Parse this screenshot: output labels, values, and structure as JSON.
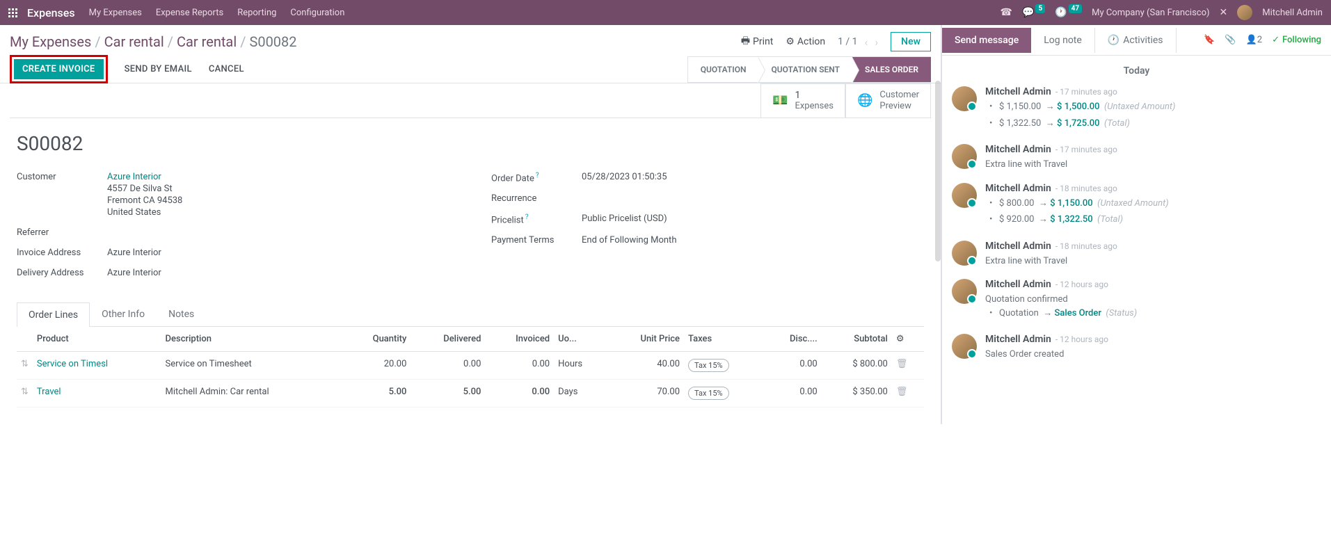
{
  "topnav": {
    "brand": "Expenses",
    "links": [
      "My Expenses",
      "Expense Reports",
      "Reporting",
      "Configuration"
    ],
    "msg_badge": "5",
    "clock_badge": "47",
    "company": "My Company (San Francisco)",
    "user": "Mitchell Admin"
  },
  "breadcrumb": {
    "parts": [
      "My Expenses",
      "Car rental",
      "Car rental"
    ],
    "current": "S00082"
  },
  "toolbar": {
    "print": "Print",
    "action": "Action",
    "pager": "1 / 1",
    "new": "New"
  },
  "actions": {
    "create_invoice": "CREATE INVOICE",
    "send_by_email": "SEND BY EMAIL",
    "cancel": "CANCEL"
  },
  "status_pills": [
    "QUOTATION",
    "QUOTATION SENT",
    "SALES ORDER"
  ],
  "widgets": {
    "expenses_count": "1",
    "expenses_label": "Expenses",
    "customer_preview_l1": "Customer",
    "customer_preview_l2": "Preview"
  },
  "record": {
    "title": "S00082",
    "labels": {
      "customer": "Customer",
      "referrer": "Referrer",
      "invoice_address": "Invoice Address",
      "delivery_address": "Delivery Address",
      "order_date": "Order Date",
      "recurrence": "Recurrence",
      "pricelist": "Pricelist",
      "payment_terms": "Payment Terms"
    },
    "customer_name": "Azure Interior",
    "customer_addr1": "4557 De Silva St",
    "customer_addr2": "Fremont CA 94538",
    "customer_addr3": "United States",
    "invoice_address": "Azure Interior",
    "delivery_address": "Azure Interior",
    "order_date": "05/28/2023 01:50:35",
    "pricelist": "Public Pricelist (USD)",
    "payment_terms": "End of Following Month"
  },
  "tabs": [
    "Order Lines",
    "Other Info",
    "Notes"
  ],
  "table": {
    "headers": {
      "product": "Product",
      "description": "Description",
      "quantity": "Quantity",
      "delivered": "Delivered",
      "invoiced": "Invoiced",
      "uom": "Uo...",
      "unit_price": "Unit Price",
      "taxes": "Taxes",
      "disc": "Disc....",
      "subtotal": "Subtotal"
    },
    "rows": [
      {
        "product": "Service on Timesl",
        "description": "Service on Timesheet",
        "quantity": "20.00",
        "delivered": "0.00",
        "invoiced": "0.00",
        "uom": "Hours",
        "unit_price": "40.00",
        "taxes": "Tax 15%",
        "disc": "0.00",
        "subtotal": "$ 800.00",
        "teal": false
      },
      {
        "product": "Travel",
        "description": "Mitchell Admin: Car rental",
        "quantity": "5.00",
        "delivered": "5.00",
        "invoiced": "0.00",
        "uom": "Days",
        "unit_price": "70.00",
        "taxes": "Tax 15%",
        "disc": "0.00",
        "subtotal": "$ 350.00",
        "teal": true
      }
    ]
  },
  "chatter": {
    "send_message": "Send message",
    "log_note": "Log note",
    "activities": "Activities",
    "follower_count": "2",
    "following": "Following",
    "today": "Today",
    "messages": [
      {
        "author": "Mitchell Admin",
        "time": "17 minutes ago",
        "type": "changes",
        "changes": [
          {
            "old": "$ 1,150.00",
            "new": "$ 1,500.00",
            "label": "(Untaxed Amount)"
          },
          {
            "old": "$ 1,322.50",
            "new": "$ 1,725.00",
            "label": "(Total)"
          }
        ]
      },
      {
        "author": "Mitchell Admin",
        "time": "17 minutes ago",
        "type": "text",
        "text": "Extra line with Travel"
      },
      {
        "author": "Mitchell Admin",
        "time": "18 minutes ago",
        "type": "changes",
        "changes": [
          {
            "old": "$ 800.00",
            "new": "$ 1,150.00",
            "label": "(Untaxed Amount)"
          },
          {
            "old": "$ 920.00",
            "new": "$ 1,322.50",
            "label": "(Total)"
          }
        ]
      },
      {
        "author": "Mitchell Admin",
        "time": "18 minutes ago",
        "type": "text",
        "text": "Extra line with Travel"
      },
      {
        "author": "Mitchell Admin",
        "time": "12 hours ago",
        "type": "quotation",
        "text": "Quotation confirmed",
        "change_old": "Quotation",
        "change_new": "Sales Order",
        "change_label": "(Status)"
      },
      {
        "author": "Mitchell Admin",
        "time": "12 hours ago",
        "type": "text",
        "text": "Sales Order created"
      }
    ]
  }
}
